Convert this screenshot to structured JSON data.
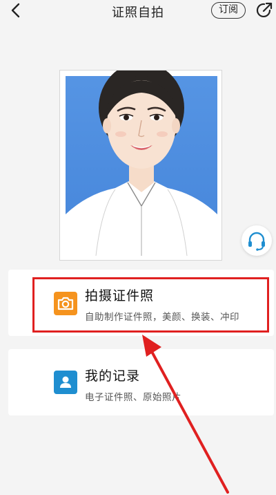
{
  "header": {
    "title": "证照自拍",
    "subscribe_label": "订阅",
    "back_icon": "chevron-left-icon",
    "share_icon": "share-icon"
  },
  "photo": {
    "description_icon": "id-photo-sample-portrait",
    "background_color": "#4f8fe0"
  },
  "support": {
    "icon": "headset-icon"
  },
  "cards": [
    {
      "title": "拍摄证件照",
      "subtitle": "自助制作证件照，美颜、换装、冲印",
      "icon": "camera-icon",
      "color": "#f5931e",
      "highlighted": true
    },
    {
      "title": "我的记录",
      "subtitle": "电子证件照、原始照片",
      "icon": "person-card-icon",
      "color": "#1f8ed0",
      "highlighted": false
    }
  ],
  "annotation": {
    "color": "#e02020"
  }
}
